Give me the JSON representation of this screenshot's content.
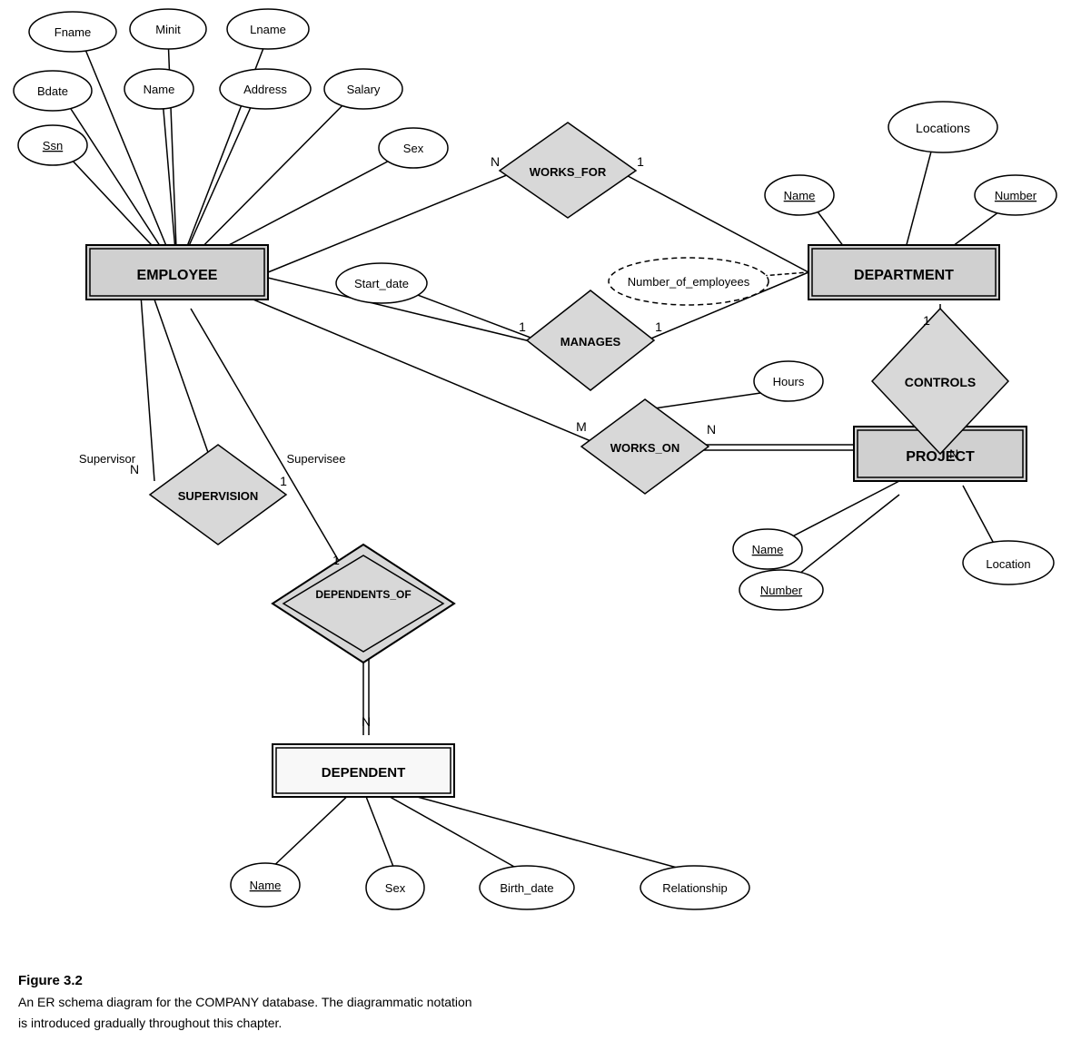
{
  "caption": {
    "title": "Figure 3.2",
    "line1": "An ER schema diagram for the COMPANY database. The diagrammatic notation",
    "line2": "is introduced gradually throughout this chapter."
  },
  "entities": {
    "employee": "EMPLOYEE",
    "department": "DEPARTMENT",
    "project": "PROJECT",
    "dependent": "DEPENDENT"
  },
  "relationships": {
    "works_for": "WORKS_FOR",
    "manages": "MANAGES",
    "works_on": "WORKS_ON",
    "controls": "CONTROLS",
    "supervision": "SUPERVISION",
    "dependents_of": "DEPENDENTS_OF"
  },
  "attributes": {
    "fname": "Fname",
    "minit": "Minit",
    "lname": "Lname",
    "bdate": "Bdate",
    "name_emp": "Name",
    "address": "Address",
    "salary": "Salary",
    "ssn": "Ssn",
    "sex_emp": "Sex",
    "start_date": "Start_date",
    "num_employees": "Number_of_employees",
    "locations": "Locations",
    "dept_name": "Name",
    "dept_number": "Number",
    "hours": "Hours",
    "proj_name": "Name",
    "proj_number": "Number",
    "location": "Location",
    "dep_name": "Name",
    "dep_sex": "Sex",
    "birth_date": "Birth_date",
    "relationship": "Relationship"
  },
  "cardinalities": {
    "n1": "N",
    "n2": "1",
    "n3": "1",
    "n4": "1",
    "n5": "M",
    "n6": "N",
    "n7": "1",
    "n8": "N",
    "n9": "N",
    "n10": "1",
    "n11": "1",
    "n12": "N",
    "supervisor": "Supervisor",
    "supervisee": "Supervisee"
  }
}
